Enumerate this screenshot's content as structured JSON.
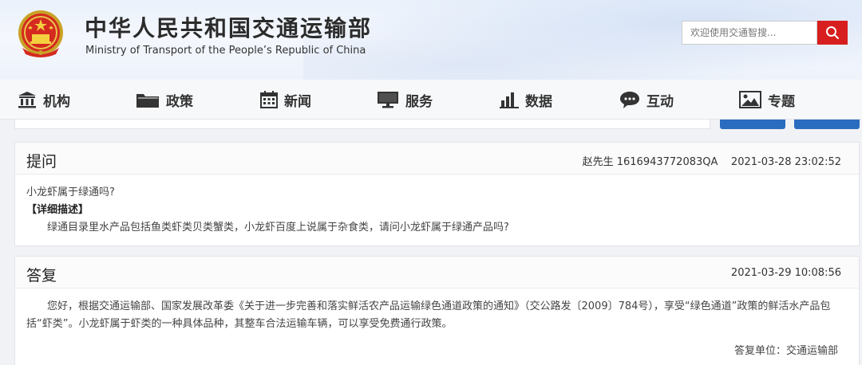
{
  "header": {
    "title": "中华人民共和国交通运输部",
    "subtitle": "Ministry of Transport of the People’s Republic of China",
    "search_placeholder": "欢迎使用交通智搜...",
    "search_icon": "search-icon",
    "brand_color": "#d71f1f"
  },
  "nav": {
    "items": [
      {
        "label": "机构",
        "icon": "building-icon"
      },
      {
        "label": "政策",
        "icon": "folder-icon"
      },
      {
        "label": "新闻",
        "icon": "calendar-icon"
      },
      {
        "label": "服务",
        "icon": "monitor-icon"
      },
      {
        "label": "数据",
        "icon": "bar-chart-icon"
      },
      {
        "label": "互动",
        "icon": "chat-icon"
      },
      {
        "label": "专题",
        "icon": "picture-icon"
      }
    ]
  },
  "question": {
    "heading": "提问",
    "asker": "赵先生",
    "id": "1616943772083QA",
    "time": "2021-03-28 23:02:52",
    "subject": "小龙虾属于绿通吗?",
    "detail_label": "【详细描述】",
    "detail": "绿通目录里水产品包括鱼类虾类贝类蟹类，小龙虾百度上说属于杂食类，请问小龙虾属于绿通产品吗?"
  },
  "answer": {
    "heading": "答复",
    "time": "2021-03-29 10:08:56",
    "body": "您好，根据交通运输部、国家发展改革委《关于进一步完善和落实鲜活农产品运输绿色通道政策的通知》（交公路发〔2009〕784号），享受“绿色通道”政策的鲜活水产品包括“虾类”。小龙虾属于虾类的一种具体品种，其整车合法运输车辆，可以享受免费通行政策。",
    "unit_label": "答复单位：",
    "unit": "交通运输部"
  }
}
